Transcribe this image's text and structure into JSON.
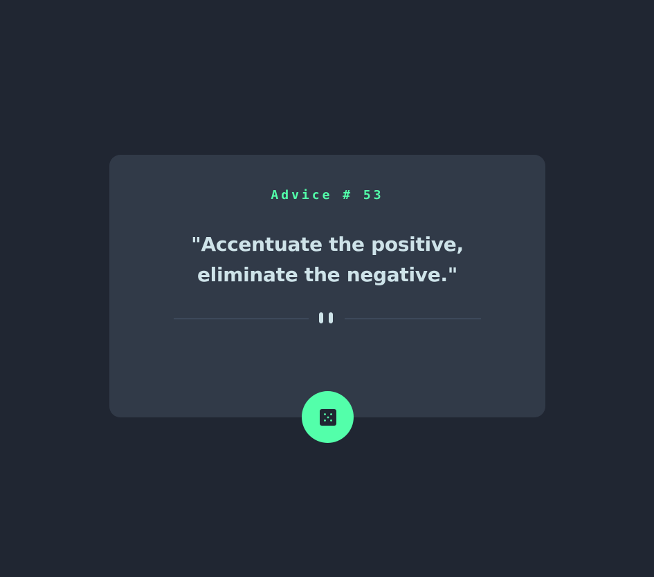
{
  "advice": {
    "label": "Advice # 53",
    "text": "\"Accentuate the positive, eliminate the negative.\""
  },
  "colors": {
    "background": "#202632",
    "card": "#313a48",
    "accent": "#53ffaa",
    "text": "#cee3e9",
    "divider": "#4f5d74"
  },
  "icons": {
    "divider": "pause-icon",
    "button": "dice-icon"
  }
}
